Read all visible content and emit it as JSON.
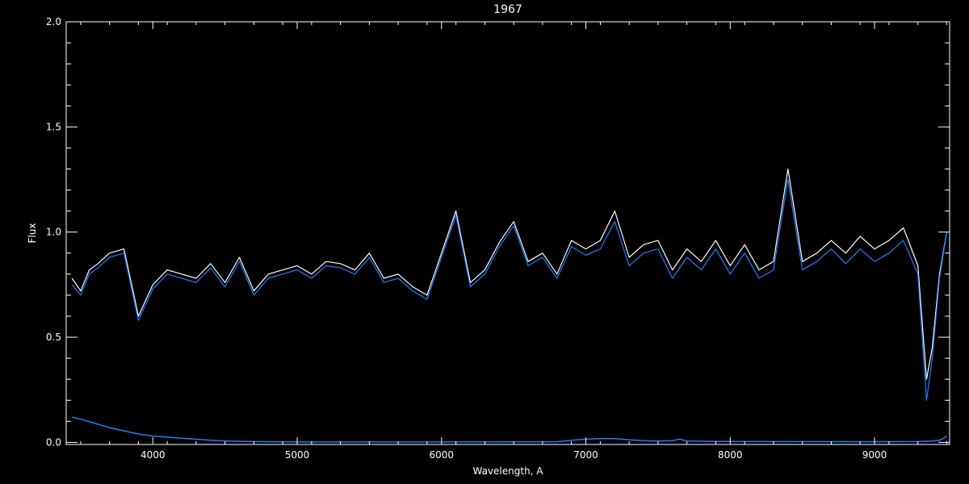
{
  "chart_data": {
    "type": "line",
    "title": "1967",
    "xlabel": "Wavelength, A",
    "ylabel": "Flux",
    "xlim": [
      3400,
      9520
    ],
    "ylim": [
      -0.01,
      2.0
    ],
    "x_ticks": [
      {
        "value": 4000,
        "label": "4000"
      },
      {
        "value": 5000,
        "label": "5000"
      },
      {
        "value": 6000,
        "label": "6000"
      },
      {
        "value": 7000,
        "label": "7000"
      },
      {
        "value": 8000,
        "label": "8000"
      },
      {
        "value": 9000,
        "label": "9000"
      }
    ],
    "y_ticks": [
      {
        "value": 0.0,
        "label": "0.0"
      },
      {
        "value": 0.5,
        "label": "0.5"
      },
      {
        "value": 1.0,
        "label": "1.0"
      },
      {
        "value": 1.5,
        "label": "1.5"
      },
      {
        "value": 2.0,
        "label": "2.0"
      }
    ],
    "grid": false,
    "colors": {
      "background": "#000000",
      "axes": "#ffffff",
      "model": "#ffffff",
      "spectrum": "#1e7fff",
      "error": "#1e7fff"
    },
    "series": [
      {
        "key": "model",
        "color": "#ffffff",
        "x": [
          3440,
          3500,
          3560,
          3620,
          3700,
          3800,
          3900,
          4000,
          4100,
          4200,
          4300,
          4400,
          4500,
          4600,
          4700,
          4800,
          4900,
          5000,
          5100,
          5200,
          5300,
          5400,
          5500,
          5600,
          5700,
          5800,
          5900,
          6000,
          6100,
          6200,
          6300,
          6400,
          6500,
          6600,
          6700,
          6800,
          6900,
          7000,
          7100,
          7200,
          7300,
          7400,
          7500,
          7600,
          7700,
          7800,
          7900,
          8000,
          8100,
          8200,
          8300,
          8400,
          8500,
          8600,
          8700,
          8800,
          8900,
          9000,
          9100,
          9200,
          9300,
          9360,
          9400,
          9450,
          9500
        ],
        "y": [
          0.78,
          0.72,
          0.82,
          0.85,
          0.9,
          0.92,
          0.6,
          0.75,
          0.82,
          0.8,
          0.78,
          0.85,
          0.76,
          0.88,
          0.72,
          0.8,
          0.82,
          0.84,
          0.8,
          0.86,
          0.85,
          0.82,
          0.9,
          0.78,
          0.8,
          0.74,
          0.7,
          0.9,
          1.1,
          0.76,
          0.82,
          0.95,
          1.05,
          0.86,
          0.9,
          0.8,
          0.96,
          0.92,
          0.96,
          1.1,
          0.88,
          0.94,
          0.96,
          0.82,
          0.92,
          0.86,
          0.96,
          0.84,
          0.94,
          0.82,
          0.86,
          1.3,
          0.86,
          0.9,
          0.96,
          0.9,
          0.98,
          0.92,
          0.96,
          1.02,
          0.84,
          0.3,
          0.45,
          0.8,
          1.0
        ]
      },
      {
        "key": "spectrum",
        "color": "#1e7fff",
        "x": [
          3440,
          3500,
          3560,
          3620,
          3700,
          3800,
          3900,
          4000,
          4100,
          4200,
          4300,
          4400,
          4500,
          4600,
          4700,
          4800,
          4900,
          5000,
          5100,
          5200,
          5300,
          5400,
          5500,
          5600,
          5700,
          5800,
          5900,
          6000,
          6100,
          6200,
          6300,
          6400,
          6500,
          6600,
          6700,
          6800,
          6900,
          7000,
          7100,
          7200,
          7300,
          7400,
          7500,
          7600,
          7700,
          7800,
          7900,
          8000,
          8100,
          8200,
          8300,
          8400,
          8500,
          8600,
          8700,
          8800,
          8900,
          9000,
          9100,
          9200,
          9300,
          9360,
          9400,
          9450,
          9500
        ],
        "y": [
          0.75,
          0.7,
          0.8,
          0.83,
          0.88,
          0.9,
          0.58,
          0.73,
          0.8,
          0.78,
          0.76,
          0.83,
          0.74,
          0.86,
          0.7,
          0.78,
          0.8,
          0.82,
          0.78,
          0.84,
          0.83,
          0.8,
          0.88,
          0.76,
          0.78,
          0.72,
          0.68,
          0.88,
          1.08,
          0.74,
          0.8,
          0.93,
          1.03,
          0.84,
          0.88,
          0.78,
          0.93,
          0.89,
          0.92,
          1.05,
          0.84,
          0.9,
          0.92,
          0.78,
          0.88,
          0.82,
          0.92,
          0.8,
          0.9,
          0.78,
          0.82,
          1.25,
          0.82,
          0.86,
          0.92,
          0.85,
          0.92,
          0.86,
          0.9,
          0.96,
          0.8,
          0.2,
          0.4,
          0.78,
          1.0
        ]
      },
      {
        "key": "error",
        "color": "#1e7fff",
        "x": [
          3440,
          3500,
          3600,
          3700,
          3800,
          3900,
          4000,
          4100,
          4200,
          4300,
          4400,
          4500,
          4600,
          4800,
          5000,
          6000,
          6800,
          6900,
          7000,
          7100,
          7200,
          7300,
          7400,
          7500,
          7600,
          7650,
          7700,
          8000,
          9000,
          9300,
          9400,
          9450,
          9480,
          9500
        ],
        "y": [
          0.12,
          0.11,
          0.09,
          0.07,
          0.055,
          0.04,
          0.03,
          0.025,
          0.02,
          0.015,
          0.01,
          0.007,
          0.005,
          0.003,
          0.002,
          0.002,
          0.003,
          0.01,
          0.015,
          0.018,
          0.018,
          0.012,
          0.008,
          0.006,
          0.008,
          0.015,
          0.006,
          0.004,
          0.003,
          0.004,
          0.006,
          0.01,
          0.02,
          0.03
        ]
      }
    ]
  }
}
